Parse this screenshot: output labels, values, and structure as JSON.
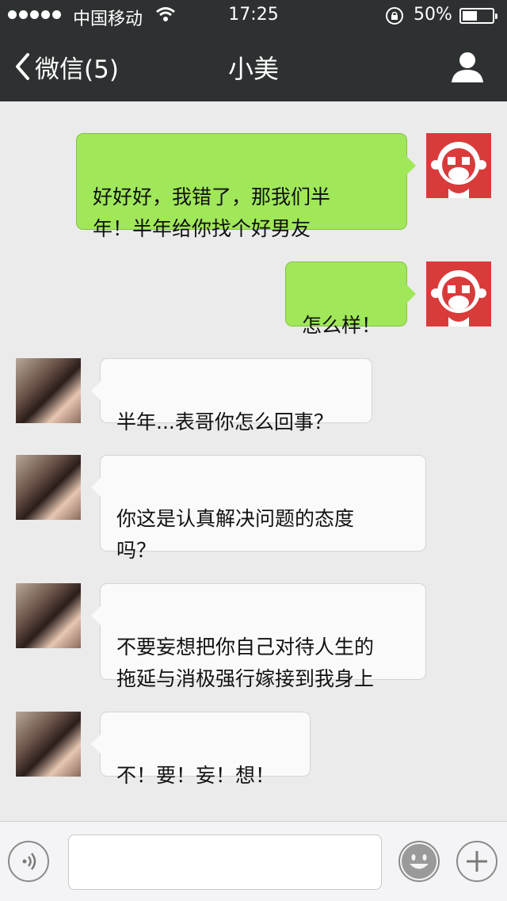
{
  "status_bar": {
    "carrier": "中国移动",
    "time": "17:25",
    "battery_percent": "50%",
    "battery_level": 0.5,
    "signal_icon": "signal-dots-icon",
    "wifi_icon": "wifi-icon",
    "rotation_lock_icon": "rotation-lock-icon"
  },
  "nav": {
    "back_label": "微信(5)",
    "title": "小美",
    "back_icon": "chevron-left-icon",
    "profile_icon": "person-icon"
  },
  "messages": [
    {
      "sender": "me",
      "text": "好好好，我错了，那我们半\n年！半年给你找个好男友"
    },
    {
      "sender": "me",
      "text": "怎么样！"
    },
    {
      "sender": "her",
      "text": "半年...表哥你怎么回事？"
    },
    {
      "sender": "her",
      "text": "你这是认真解决问题的态度\n吗？"
    },
    {
      "sender": "her",
      "text": "不要妄想把你自己对待人生的\n拖延与消极强行嫁接到我身上"
    },
    {
      "sender": "her",
      "text": "不！要！妄！想！"
    }
  ],
  "input_bar": {
    "voice_icon": "voice-icon",
    "emoji_icon": "emoji-icon",
    "plus_icon": "plus-icon",
    "text_value": ""
  },
  "colors": {
    "nav_background": "#2e3132",
    "chat_background": "#ebebeb",
    "outgoing_bubble": "#a0e75a",
    "incoming_bubble": "#fafafa",
    "my_avatar": "#d93b3b"
  }
}
